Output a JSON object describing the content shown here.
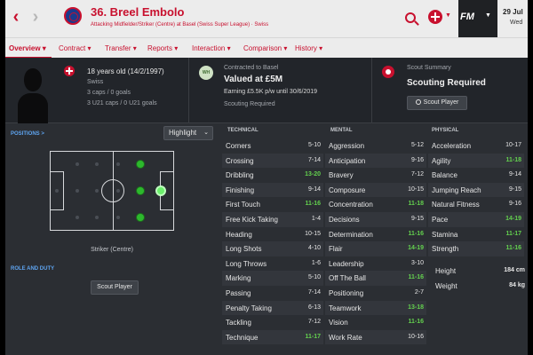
{
  "header": {
    "title": "36. Breel Embolo",
    "subtitle": "Attacking Midfielder/Striker (Centre) at Basel (Swiss Super League) · Swiss",
    "fm_logo": "FM",
    "date_day": "29 Jul",
    "date_weekday": "Wed",
    "nav_back_icon": "chevron-left-icon",
    "nav_forward_icon": "chevron-right-icon",
    "accent_color": "#c8102e"
  },
  "tabs": [
    {
      "label": "Overview"
    },
    {
      "label": "Contract"
    },
    {
      "label": "Transfer"
    },
    {
      "label": "Reports"
    },
    {
      "label": "Interaction"
    },
    {
      "label": "Comparison"
    },
    {
      "label": "History"
    }
  ],
  "profile": {
    "age": "18 years old (14/2/1997)",
    "nationality": "Swiss",
    "caps": "3 caps / 0 goals",
    "u21_caps": "3 U21 caps / 0 U21 goals"
  },
  "contract": {
    "club_logo_text": "WH",
    "label": "Contracted to Basel",
    "value": "Valued at £5M",
    "earnings": "Earning £5.5K p/w until 30/6/2019",
    "status": "Scouting Required"
  },
  "scout": {
    "label": "Scout Summary",
    "value": "Scouting Required",
    "button": "Scout Player"
  },
  "positions": {
    "link": "POSITIONS >",
    "highlight": "Highlight",
    "caption": "Striker (Centre)",
    "role_link": "ROLE AND DUTY",
    "scout_button": "Scout Player"
  },
  "attributes": {
    "technical_title": "TECHNICAL",
    "mental_title": "MENTAL",
    "physical_title": "PHYSICAL",
    "technical": [
      {
        "name": "Corners",
        "value": "5-10"
      },
      {
        "name": "Crossing",
        "value": "7-14"
      },
      {
        "name": "Dribbling",
        "value": "13-20",
        "good": true
      },
      {
        "name": "Finishing",
        "value": "9-14"
      },
      {
        "name": "First Touch",
        "value": "11-16",
        "good": true
      },
      {
        "name": "Free Kick Taking",
        "value": "1-4"
      },
      {
        "name": "Heading",
        "value": "10-15"
      },
      {
        "name": "Long Shots",
        "value": "4-10"
      },
      {
        "name": "Long Throws",
        "value": "1-6"
      },
      {
        "name": "Marking",
        "value": "5-10"
      },
      {
        "name": "Passing",
        "value": "7-14"
      },
      {
        "name": "Penalty Taking",
        "value": "6-13"
      },
      {
        "name": "Tackling",
        "value": "7-12"
      },
      {
        "name": "Technique",
        "value": "11-17",
        "good": true
      }
    ],
    "mental": [
      {
        "name": "Aggression",
        "value": "5-12"
      },
      {
        "name": "Anticipation",
        "value": "9-16"
      },
      {
        "name": "Bravery",
        "value": "7-12"
      },
      {
        "name": "Composure",
        "value": "10-15"
      },
      {
        "name": "Concentration",
        "value": "11-18",
        "good": true
      },
      {
        "name": "Decisions",
        "value": "9-15"
      },
      {
        "name": "Determination",
        "value": "11-16",
        "good": true
      },
      {
        "name": "Flair",
        "value": "14-19",
        "good": true
      },
      {
        "name": "Leadership",
        "value": "3-10"
      },
      {
        "name": "Off The Ball",
        "value": "11-16",
        "good": true
      },
      {
        "name": "Positioning",
        "value": "2-7"
      },
      {
        "name": "Teamwork",
        "value": "13-18",
        "good": true
      },
      {
        "name": "Vision",
        "value": "11-16",
        "good": true
      },
      {
        "name": "Work Rate",
        "value": "10-16"
      }
    ],
    "physical": [
      {
        "name": "Acceleration",
        "value": "10-17"
      },
      {
        "name": "Agility",
        "value": "11-18",
        "good": true
      },
      {
        "name": "Balance",
        "value": "9-14"
      },
      {
        "name": "Jumping Reach",
        "value": "9-15"
      },
      {
        "name": "Natural Fitness",
        "value": "9-16"
      },
      {
        "name": "Pace",
        "value": "14-19",
        "good": true
      },
      {
        "name": "Stamina",
        "value": "11-17",
        "good": true
      },
      {
        "name": "Strength",
        "value": "11-16",
        "good": true
      }
    ],
    "extras": [
      {
        "name": "Height",
        "value": "184 cm"
      },
      {
        "name": "Weight",
        "value": "84 kg"
      }
    ]
  }
}
